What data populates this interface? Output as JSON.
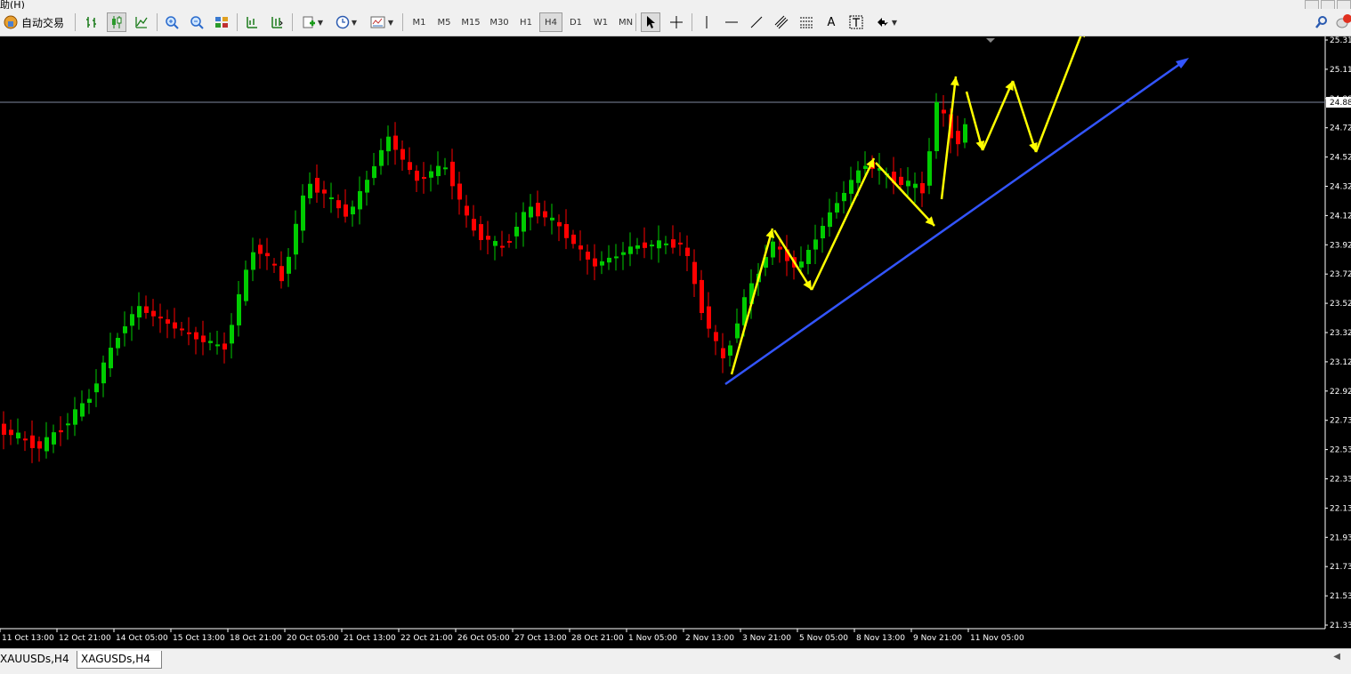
{
  "menu": {
    "partial_label": "助(H)"
  },
  "toolbar": {
    "autotrade_label": "自动交易",
    "timeframes": [
      "M1",
      "M5",
      "M15",
      "M30",
      "H1",
      "H4",
      "D1",
      "W1",
      "MN"
    ],
    "active_timeframe": "H4",
    "text_tool_label": "A"
  },
  "chart": {
    "background": "#000000",
    "bull_color": "#00cc00",
    "bear_color": "#ff0000",
    "yaxis_labels": [
      "25.31",
      "25.11",
      "24.88",
      "24.72",
      "24.52",
      "24.32",
      "24.12",
      "23.92",
      "23.72",
      "23.52",
      "23.32",
      "23.12",
      "22.92",
      "22.73",
      "22.53",
      "22.33",
      "22.13",
      "21.93",
      "21.73",
      "21.53",
      "21.33"
    ],
    "current_price": "24.88",
    "xaxis_labels": [
      "11 Oct 13:00",
      "12 Oct 21:00",
      "14 Oct 05:00",
      "15 Oct 13:00",
      "18 Oct 21:00",
      "20 Oct 05:00",
      "21 Oct 13:00",
      "22 Oct 21:00",
      "26 Oct 05:00",
      "27 Oct 13:00",
      "28 Oct 21:00",
      "1 Nov 05:00",
      "2 Nov 13:00",
      "3 Nov 21:00",
      "5 Nov 05:00",
      "8 Nov 13:00",
      "9 Nov 21:00",
      "11 Nov 05:00"
    ],
    "trendline_color": "#3355ff",
    "arrow_color": "#ffff00"
  },
  "tabs": [
    {
      "label": "XAUUSDs,H4",
      "active": false
    },
    {
      "label": "XAGUSDs,H4",
      "active": true
    }
  ]
}
